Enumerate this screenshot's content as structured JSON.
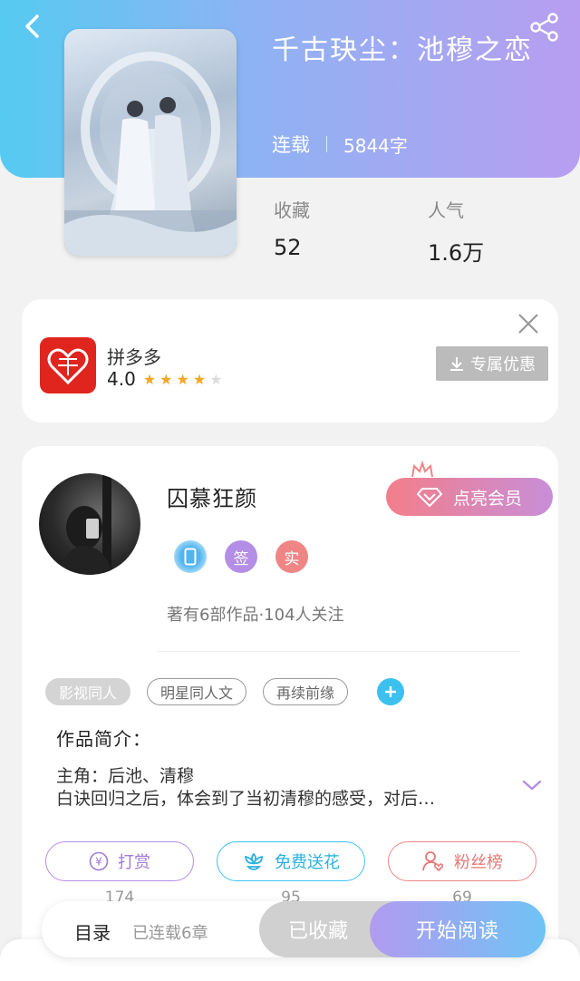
{
  "book": {
    "title": "千古玦尘：池穆之恋",
    "status": "连载",
    "word_count": "5844字",
    "stats": [
      {
        "label": "收藏",
        "value": "52"
      },
      {
        "label": "人气",
        "value": "1.6万"
      }
    ]
  },
  "ad": {
    "app_name": "拼多多",
    "rating": "4.0",
    "rating_stars": 4,
    "rating_max": 5,
    "button_label": "专属优惠"
  },
  "author": {
    "name": "囚慕狂颜",
    "vip_label": "点亮会员",
    "badges": [
      "签",
      "实"
    ],
    "stats_text": "著有6部作品·104人关注"
  },
  "tags": [
    "影视同人",
    "明星同人文",
    "再续前缘"
  ],
  "intro": {
    "title": "作品简介：",
    "line1": "主角：后池、清穆",
    "line2": "白诀回归之后，体会到了当初清穆的感受，对后…"
  },
  "actions": [
    {
      "label": "打赏",
      "count": "174"
    },
    {
      "label": "免费送花",
      "count": "95"
    },
    {
      "label": "粉丝榜",
      "count": "69"
    }
  ],
  "bottom_bar": {
    "toc_label": "目录",
    "toc_status": "已连载6章",
    "faved_label": "已收藏",
    "read_label": "开始阅读"
  },
  "colors": {
    "header_start": "#55cbf2",
    "header_end": "#b89ef0",
    "purple": "#b48ee6",
    "cyan": "#3cc1ee",
    "pink": "#f08585",
    "brand_red": "#e0251f"
  }
}
